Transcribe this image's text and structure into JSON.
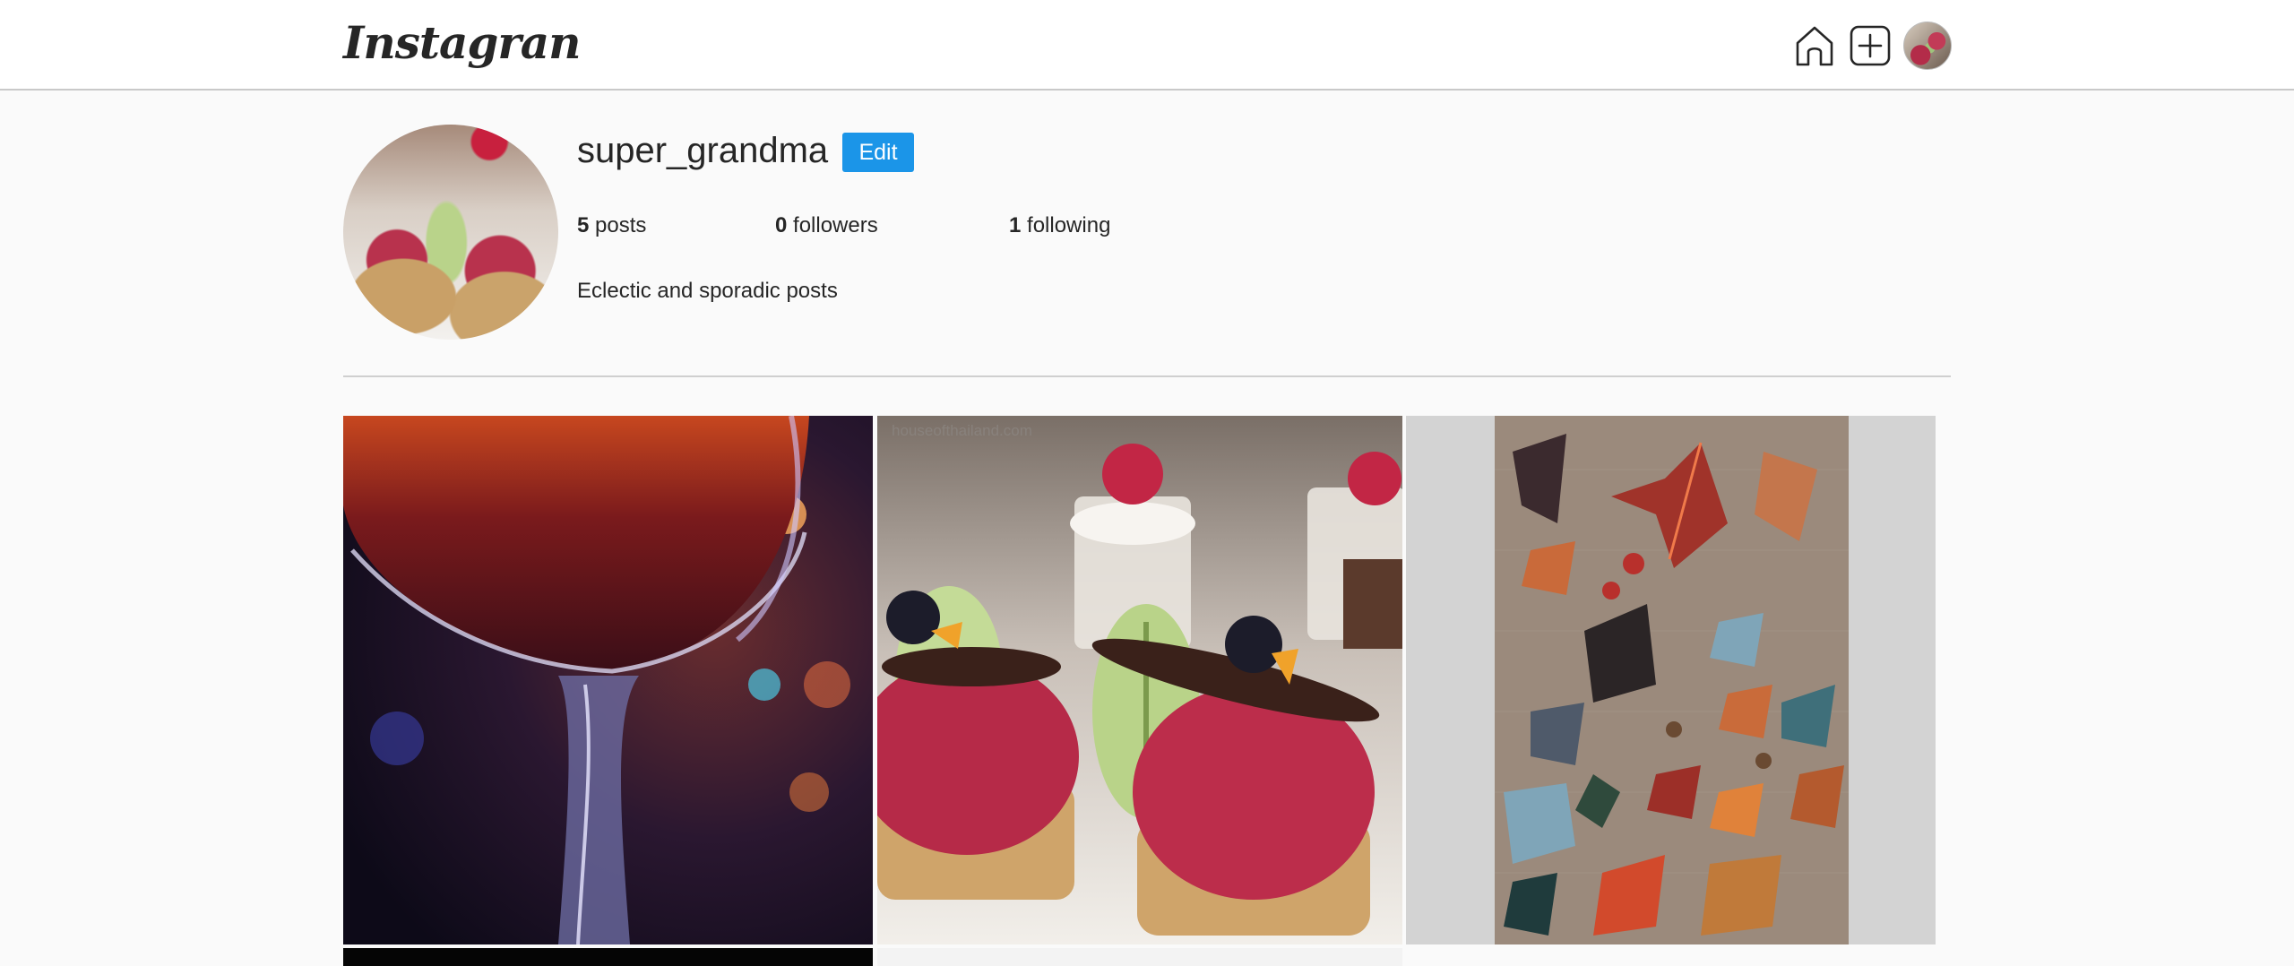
{
  "header": {
    "logo_text": "Instagran",
    "nav": [
      {
        "name": "home-icon"
      },
      {
        "name": "new-post-icon"
      },
      {
        "name": "avatar"
      }
    ]
  },
  "profile": {
    "username": "super_grandma",
    "edit_label": "Edit",
    "stats": {
      "posts_count": "5",
      "posts_label": " posts",
      "followers_count": "0",
      "followers_label": " followers",
      "following_count": "1",
      "following_label": " following"
    },
    "bio": "Eclectic and sporadic posts"
  },
  "posts": [
    {
      "subject": "wine glass"
    },
    {
      "subject": "raspberry tarts and macarons",
      "watermark": "houseofthailand.com"
    },
    {
      "subject": "autumn leaves flat lay"
    },
    {
      "subject": "dark image"
    },
    {
      "subject": "light image"
    }
  ]
}
